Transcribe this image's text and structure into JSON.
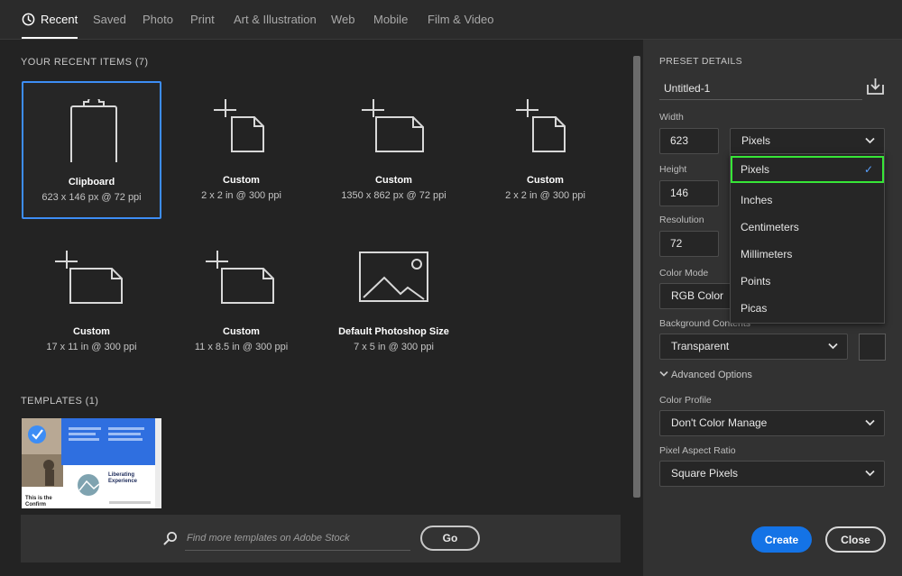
{
  "tabs": [
    {
      "label": "Recent",
      "active": true
    },
    {
      "label": "Saved"
    },
    {
      "label": "Photo"
    },
    {
      "label": "Print"
    },
    {
      "label": "Art & Illustration"
    },
    {
      "label": "Web"
    },
    {
      "label": "Mobile"
    },
    {
      "label": "Film & Video"
    }
  ],
  "recent": {
    "title": "YOUR RECENT ITEMS",
    "count": "(7)",
    "items": [
      {
        "name": "Clipboard",
        "meta": "623 x 146 px @ 72 ppi",
        "icon": "clipboard-icon"
      },
      {
        "name": "Custom",
        "meta": "2 x 2 in @ 300 ppi",
        "icon": "custom-document-icon"
      },
      {
        "name": "Custom",
        "meta": "1350 x 862 px @ 72 ppi",
        "icon": "custom-document-icon"
      },
      {
        "name": "Custom",
        "meta": "2 x 2 in @ 300 ppi",
        "icon": "custom-document-icon"
      },
      {
        "name": "Custom",
        "meta": "17 x 11 in @ 300 ppi",
        "icon": "custom-document-icon"
      },
      {
        "name": "Custom",
        "meta": "11 x 8.5 in @ 300 ppi",
        "icon": "custom-document-icon"
      },
      {
        "name": "Default Photoshop Size",
        "meta": "7 x 5 in @ 300 ppi",
        "icon": "image-icon"
      }
    ]
  },
  "templates": {
    "title": "TEMPLATES",
    "count": "(1)",
    "thumb_text": {
      "headline": "Liberating Experience",
      "caption": "This is the Confirm"
    }
  },
  "search": {
    "placeholder": "Find more templates on Adobe Stock",
    "go_label": "Go"
  },
  "details": {
    "title": "PRESET DETAILS",
    "name": "Untitled-1",
    "width_label": "Width",
    "width_value": "623",
    "width_unit": "Pixels",
    "height_label": "Height",
    "height_value": "146",
    "resolution_label": "Resolution",
    "resolution_value": "72",
    "color_mode_label": "Color Mode",
    "color_mode_value": "RGB Color",
    "background_label": "Background Contents",
    "background_value": "Transparent",
    "advanced_label": "Advanced Options",
    "color_profile_label": "Color Profile",
    "color_profile_value": "Don't Color Manage",
    "aspect_label": "Pixel Aspect Ratio",
    "aspect_value": "Square Pixels",
    "create_label": "Create",
    "close_label": "Close"
  },
  "unit_menu": {
    "options": [
      "Pixels",
      "Inches",
      "Centimeters",
      "Millimeters",
      "Points",
      "Picas"
    ],
    "selected": "Pixels"
  },
  "colors": {
    "accent": "#1473e6",
    "selection_border": "#3d8df5",
    "highlight_outline": "#37e637"
  }
}
